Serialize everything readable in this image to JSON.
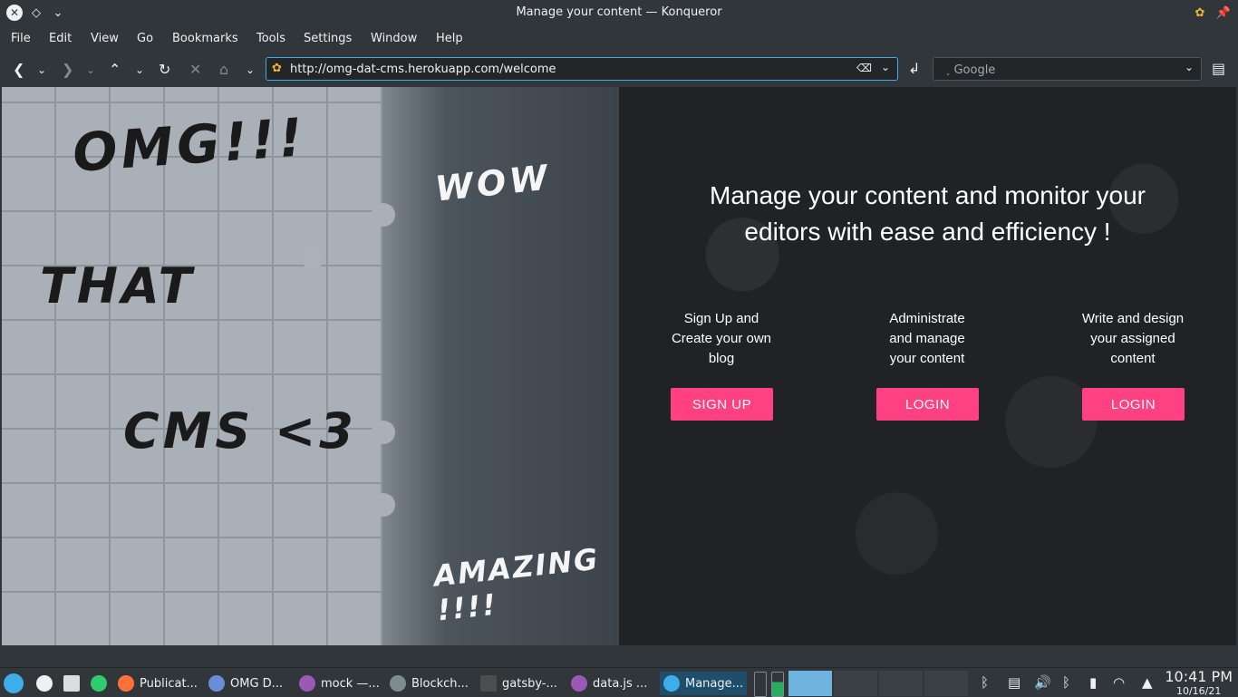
{
  "window": {
    "title": "Manage your content — Konqueror"
  },
  "menu": [
    "File",
    "Edit",
    "View",
    "Go",
    "Bookmarks",
    "Tools",
    "Settings",
    "Window",
    "Help"
  ],
  "address": {
    "url": "http://omg-dat-cms.herokuapp.com/welcome"
  },
  "search": {
    "placeholder": "˯ Google"
  },
  "page": {
    "graffiti": {
      "omg": "OMG!!!",
      "that": "THAT",
      "cms": "CMS <3",
      "wow": "WOW",
      "amazing": "AMAZING !!!!"
    },
    "headline_line1": "Manage your content and monitor your",
    "headline_line2": "editors with ease and efficiency !",
    "columns": [
      {
        "lines": [
          "Sign Up and",
          "Create your own",
          "blog"
        ],
        "button": "SIGN UP"
      },
      {
        "lines": [
          "Administrate",
          "and manage",
          "your content"
        ],
        "button": "LOGIN"
      },
      {
        "lines": [
          "Write and design",
          "your assigned",
          "content"
        ],
        "button": "LOGIN"
      }
    ],
    "accent_color": "#ff4081"
  },
  "taskbar": {
    "tasks": [
      "Publicat...",
      "OMG D...",
      "mock —...",
      "Blockch...",
      "gatsby-...",
      "data.js  ...",
      "Manage..."
    ],
    "time": "10:41 PM",
    "date": "10/16/21"
  }
}
